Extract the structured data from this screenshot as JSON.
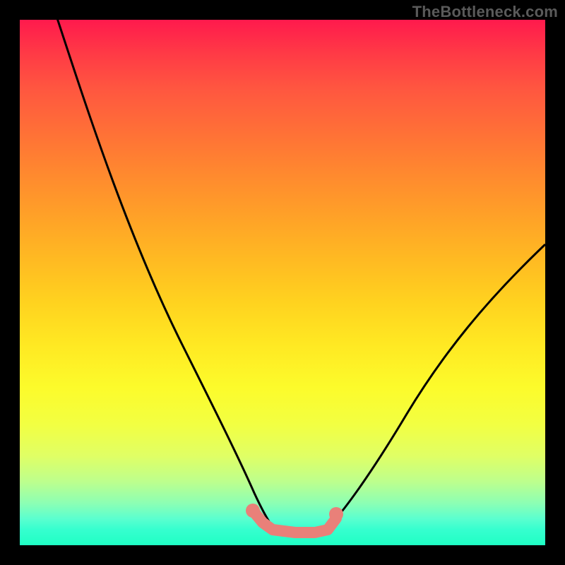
{
  "watermark": "TheBottleneck.com",
  "chart_data": {
    "type": "line",
    "title": "",
    "xlabel": "",
    "ylabel": "",
    "xlim": [
      0,
      100
    ],
    "ylim": [
      0,
      100
    ],
    "series": [
      {
        "name": "left-curve",
        "x": [
          10,
          15,
          20,
          25,
          30,
          35,
          40,
          43,
          46,
          48
        ],
        "y": [
          100,
          88,
          73,
          60,
          48,
          36,
          23,
          14,
          8,
          4
        ]
      },
      {
        "name": "right-curve",
        "x": [
          60,
          63,
          67,
          72,
          78,
          85,
          92,
          100
        ],
        "y": [
          5,
          8,
          13,
          21,
          31,
          41,
          50,
          57
        ]
      },
      {
        "name": "bottom-segment",
        "style": "thick-salmon",
        "x": [
          44,
          46,
          48,
          52,
          56,
          58,
          60
        ],
        "y": [
          6.5,
          4.5,
          3.5,
          3.0,
          3.0,
          3.5,
          5.0
        ]
      }
    ],
    "dots": [
      {
        "x": 44,
        "y": 7
      },
      {
        "x": 60,
        "y": 6
      }
    ],
    "colors": {
      "curve": "#000000",
      "segment": "#e98079",
      "frame": "#000000"
    }
  }
}
